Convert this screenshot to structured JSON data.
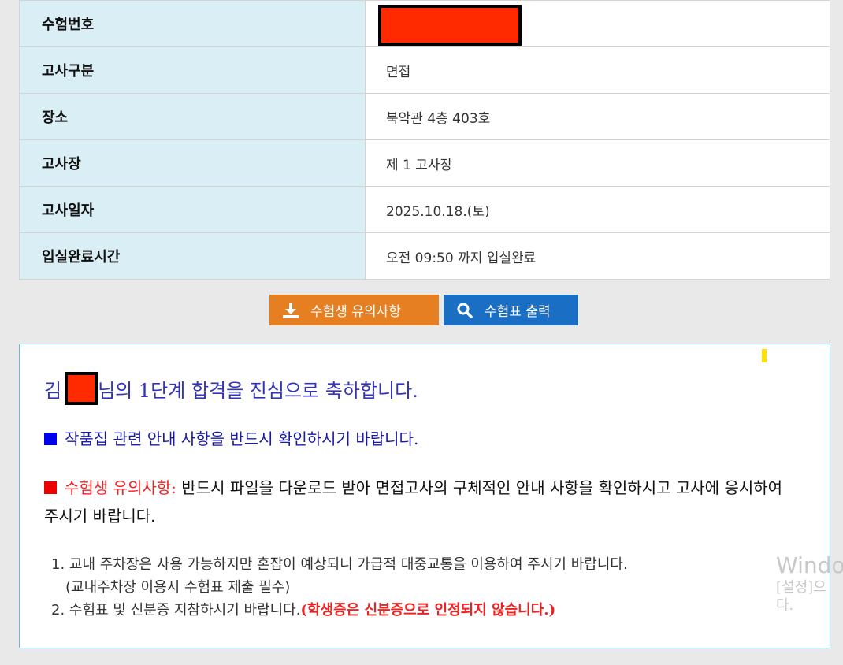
{
  "info": [
    {
      "label": "수험번호",
      "value": ""
    },
    {
      "label": "고사구분",
      "value": "면접"
    },
    {
      "label": "장소",
      "value": "북악관 4층 403호"
    },
    {
      "label": "고사장",
      "value": "제 1 고사장"
    },
    {
      "label": "고사일자",
      "value": "2025.10.18.(토)"
    },
    {
      "label": "입실완료시간",
      "value": "오전 09:50 까지 입실완료"
    }
  ],
  "buttons": {
    "notice_label": "수험생 유의사항",
    "print_label": "수험표 출력"
  },
  "notice": {
    "congrats_prefix": "김",
    "congrats_suffix": "님의 1단계 합격을 진심으로 축하합니다.",
    "portfolio_line": "작품집 관련 안내 사항을 반드시 확인하시기 바랍니다.",
    "caution_label": "수험생 유의사항:",
    "caution_text": "반드시 파일을 다운로드 받아 면접고사의 구체적인 안내 사항을 확인하시고 고사에 응시하여 주시기 바랍니다.",
    "item1": "1. 교내 주차장은 사용 가능하지만 혼잡이 예상되니 가급적 대중교통을 이용하여 주시기 바랍니다.",
    "item1_sub": "(교내주차장 이용시 수험표 제출 필수)",
    "item2": "2. 수험표 및 신분증 지참하시기 바랍니다.",
    "item2_warn": "(학생증은 신분증으로 인정되지 않습니다.)"
  },
  "watermark": {
    "line1": "Windo",
    "line2": "[설정]으",
    "line3": "다."
  },
  "colors": {
    "label_bg": "#daeef5",
    "orange_button": "#e67e22",
    "blue_button": "#1a6fc4",
    "redaction": "#ff2a00"
  }
}
